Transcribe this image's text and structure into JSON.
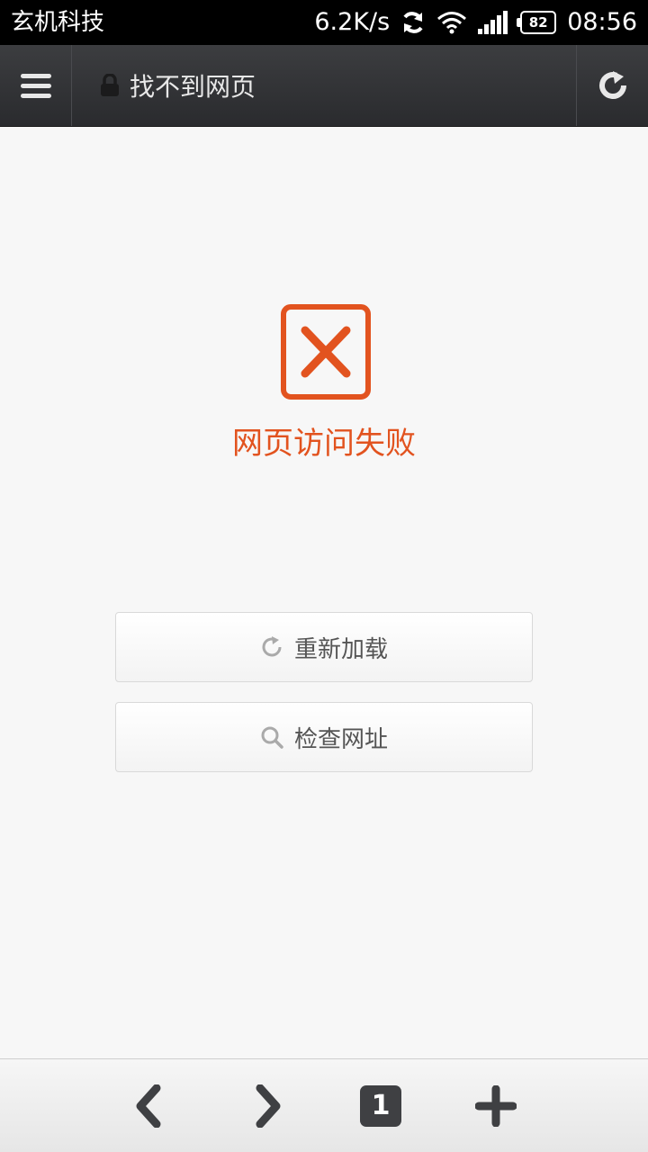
{
  "status_bar": {
    "carrier": "玄机科技",
    "speed": "6.2K/s",
    "battery": "82",
    "time": "08:56"
  },
  "title_bar": {
    "title": "找不到网页"
  },
  "error": {
    "message": "网页访问失败",
    "color": "#e2531f"
  },
  "actions": {
    "reload_label": "重新加载",
    "check_label": "检查网址"
  },
  "bottom_bar": {
    "tab_count": "1"
  }
}
